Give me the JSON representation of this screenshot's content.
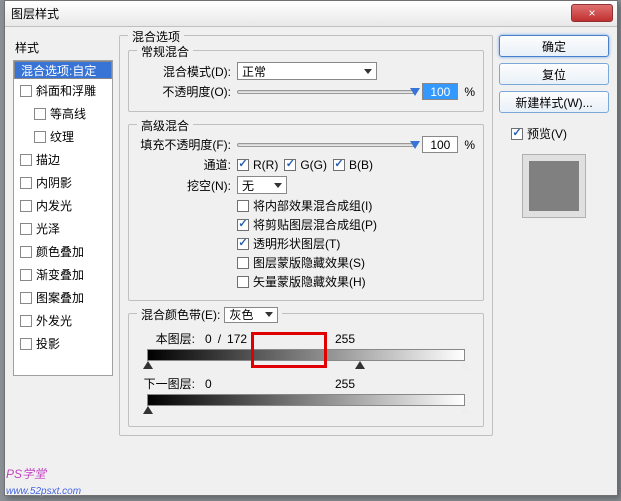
{
  "window": {
    "title": "图层样式",
    "close": "×"
  },
  "sidebar": {
    "header": "样式",
    "items": [
      {
        "label": "混合选项:自定",
        "checked": null,
        "sel": true
      },
      {
        "label": "斜面和浮雕",
        "checked": false
      },
      {
        "label": "等高线",
        "checked": false,
        "indent": true
      },
      {
        "label": "纹理",
        "checked": false,
        "indent": true
      },
      {
        "label": "描边",
        "checked": false
      },
      {
        "label": "内阴影",
        "checked": false
      },
      {
        "label": "内发光",
        "checked": false
      },
      {
        "label": "光泽",
        "checked": false
      },
      {
        "label": "颜色叠加",
        "checked": false
      },
      {
        "label": "渐变叠加",
        "checked": false
      },
      {
        "label": "图案叠加",
        "checked": false
      },
      {
        "label": "外发光",
        "checked": false
      },
      {
        "label": "投影",
        "checked": false
      }
    ]
  },
  "main": {
    "title": "混合选项",
    "general": {
      "title": "常规混合",
      "mode_label": "混合模式(D):",
      "mode_value": "正常",
      "opacity_label": "不透明度(O):",
      "opacity_value": "100",
      "opacity_unit": "%"
    },
    "advanced": {
      "title": "高级混合",
      "fill_label": "填充不透明度(F):",
      "fill_value": "100",
      "fill_unit": "%",
      "channel_label": "通道:",
      "r": "R(R)",
      "g": "G(G)",
      "b": "B(B)",
      "knockout_label": "挖空(N):",
      "knockout_value": "无",
      "opts": [
        {
          "label": "将内部效果混合成组(I)",
          "checked": false
        },
        {
          "label": "将剪贴图层混合成组(P)",
          "checked": true
        },
        {
          "label": "透明形状图层(T)",
          "checked": true
        },
        {
          "label": "图层蒙版隐藏效果(S)",
          "checked": false
        },
        {
          "label": "矢量蒙版隐藏效果(H)",
          "checked": false
        }
      ]
    },
    "blendif": {
      "title": "混合颜色带(E):",
      "value": "灰色",
      "this_label": "本图层:",
      "this_lo": "0",
      "this_sep": "/",
      "this_hi": "172",
      "this_max": "255",
      "under_label": "下一图层:",
      "under_lo": "0",
      "under_max": "255"
    }
  },
  "right": {
    "ok": "确定",
    "cancel": "复位",
    "newstyle": "新建样式(W)...",
    "preview": "预览(V)"
  },
  "watermark": {
    "line1": "PS学堂",
    "line2": "www.52psxt.com"
  }
}
